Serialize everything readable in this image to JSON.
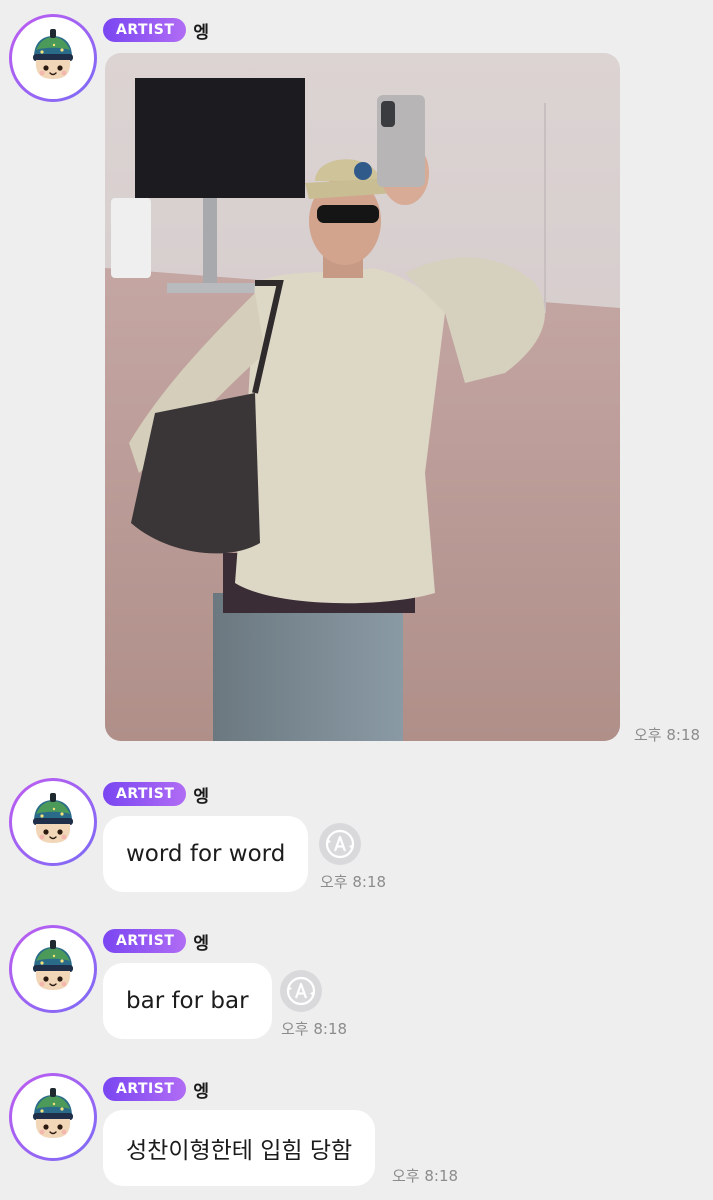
{
  "accent": {
    "badge_start": "#7a46f2",
    "badge_end": "#b06cf4",
    "avatar_ring": "#b46cf2"
  },
  "messages": [
    {
      "badge": "ARTIST",
      "sender": "엥",
      "type": "image",
      "avatar_icon": "mascot-avatar-icon",
      "time": "오후 8:18"
    },
    {
      "badge": "ARTIST",
      "sender": "엥",
      "type": "text",
      "text": "word for word",
      "time": "오후 8:18",
      "translate_icon": "translate-icon"
    },
    {
      "badge": "ARTIST",
      "sender": "엥",
      "type": "text",
      "text": "bar for bar",
      "time": "오후 8:18",
      "translate_icon": "translate-icon"
    },
    {
      "badge": "ARTIST",
      "sender": "엥",
      "type": "text",
      "text": "성찬이형한테 입힘 당함",
      "time": "오후 8:18"
    }
  ]
}
